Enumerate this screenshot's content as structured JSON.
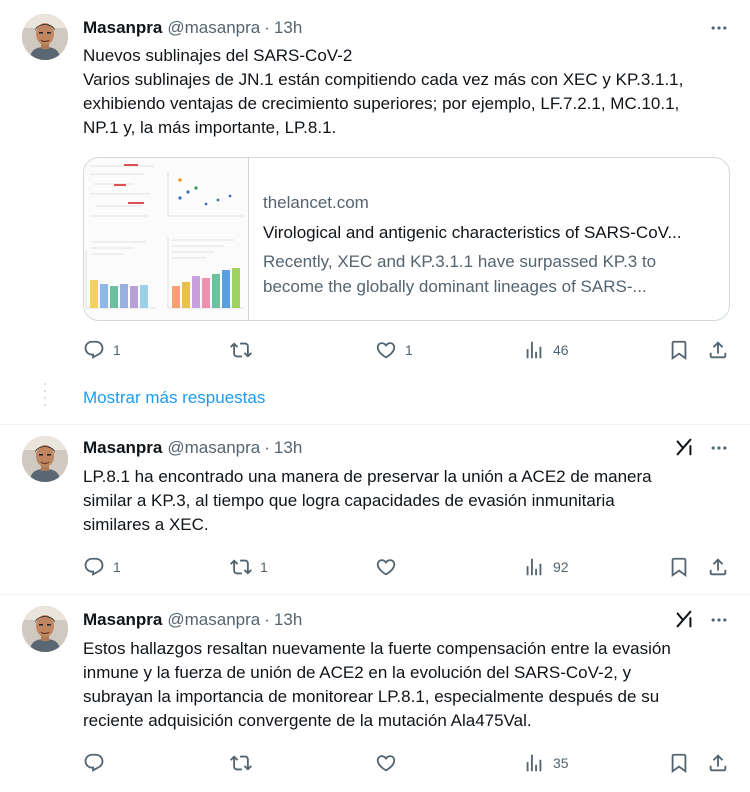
{
  "colors": {
    "text": "#0f1419",
    "secondary": "#536471",
    "link": "#1d9bf0",
    "border": "#cfd9de"
  },
  "tweets": [
    {
      "name": "Masanpra",
      "handle": "@masanpra",
      "time": "13h",
      "lines": [
        "Nuevos sublinajes del SARS-CoV-2",
        "Varios sublinajes de JN.1 están compitiendo cada vez más con XEC y KP.3.1.1,",
        "exhibiendo ventajas de crecimiento superiores; por ejemplo, LF.7.2.1, MC.10.1,",
        "NP.1 y, la más importante, LP.8.1."
      ],
      "card": {
        "domain": "thelancet.com",
        "title": "Virological and antigenic characteristics of SARS-CoV...",
        "desc_lines": [
          "Recently, XEC and KP.3.1.1 have surpassed KP.3 to",
          "become the globally dominant lineages of SARS-..."
        ],
        "thumbnail": "figure-thumbnail"
      },
      "actions": {
        "replies": "1",
        "reposts": "",
        "likes": "1",
        "views": "46"
      }
    },
    {
      "name": "Masanpra",
      "handle": "@masanpra",
      "time": "13h",
      "lines": [
        "LP.8.1 ha encontrado una manera de preservar la unión a ACE2 de manera",
        "similar a KP.3, al tiempo que logra capacidades de evasión inmunitaria",
        "similares a XEC."
      ],
      "actions": {
        "replies": "1",
        "reposts": "1",
        "likes": "",
        "views": "92"
      }
    },
    {
      "name": "Masanpra",
      "handle": "@masanpra",
      "time": "13h",
      "lines": [
        "Estos hallazgos resaltan nuevamente la fuerte compensación entre la evasión",
        "inmune y la fuerza de unión de ACE2 en la evolución del SARS-CoV-2, y",
        "subrayan la importancia de monitorear LP.8.1, especialmente después de su",
        "reciente adquisición convergente de la mutación Ala475Val."
      ],
      "actions": {
        "replies": "",
        "reposts": "",
        "likes": "",
        "views": "35"
      }
    }
  ],
  "show_more": "Mostrar más respuestas",
  "icons": [
    "more-icon",
    "grok-icon",
    "reply-icon",
    "repost-icon",
    "like-icon",
    "views-icon",
    "bookmark-icon",
    "share-icon"
  ]
}
